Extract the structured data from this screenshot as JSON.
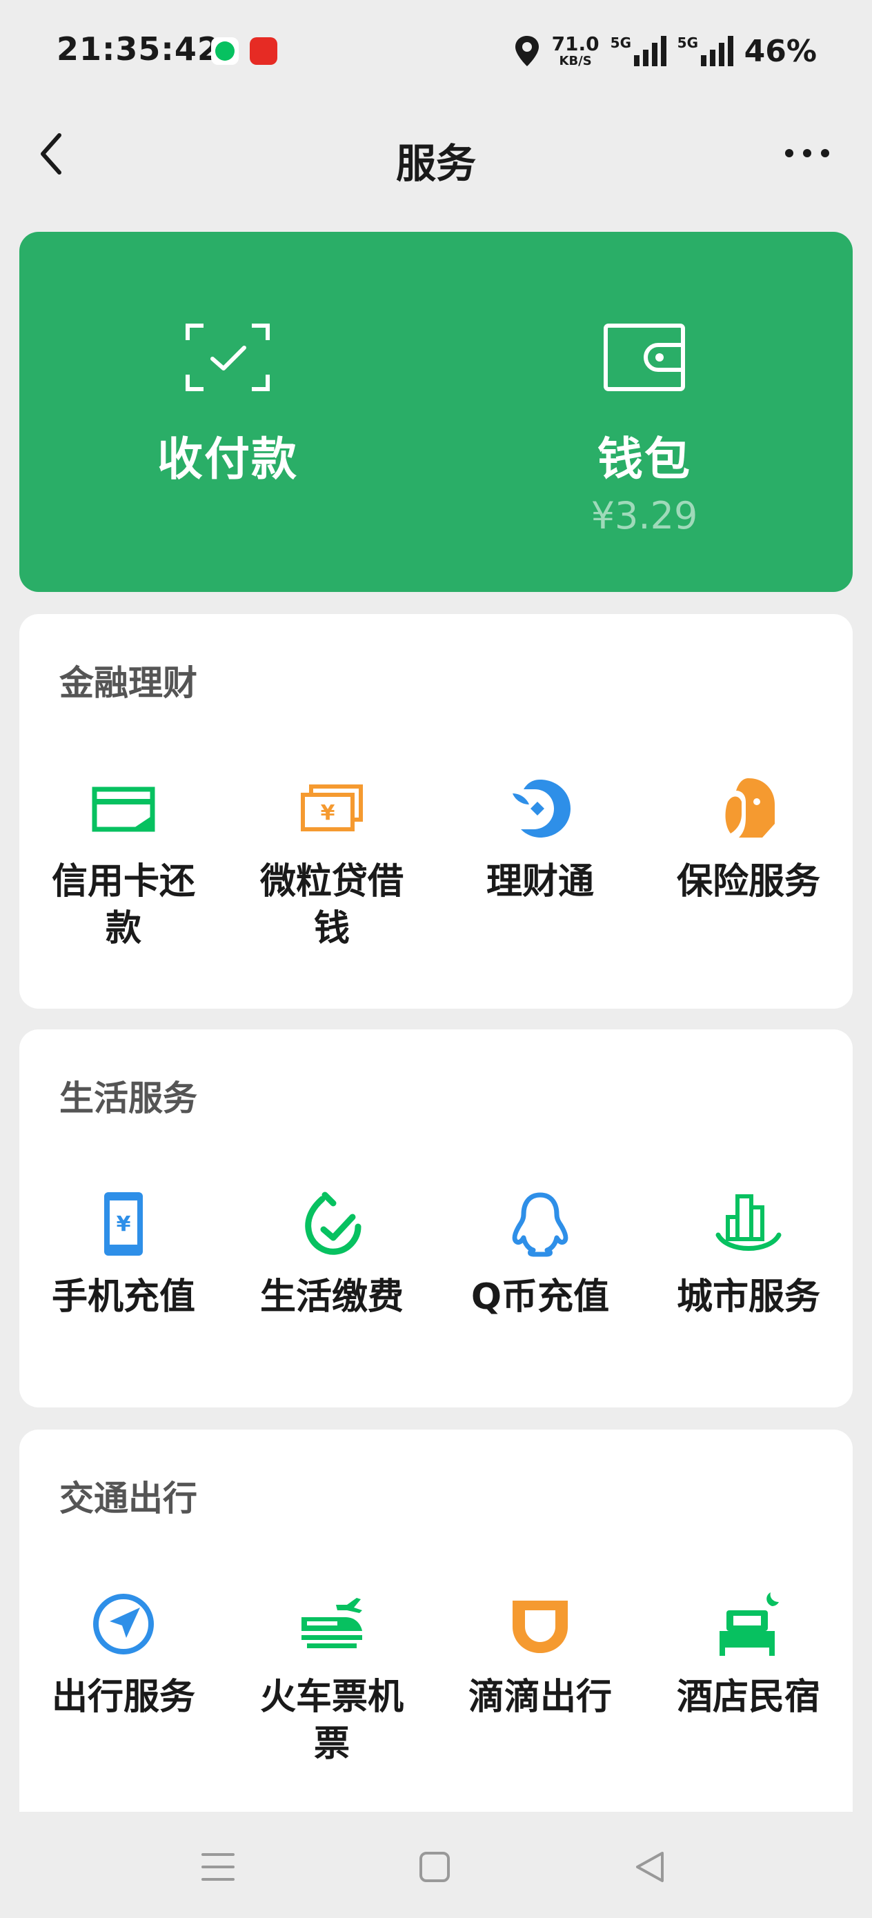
{
  "status_bar": {
    "time": "21:35:42",
    "net_speed": "71.0",
    "net_unit": "KB/S",
    "sim1": "5G",
    "sim2": "5G",
    "battery": "46%",
    "icons": [
      "messaging-app-icon",
      "cloud-pay-app-icon",
      "location-icon",
      "signal-icon"
    ]
  },
  "nav": {
    "title": "服务",
    "back_icon": "chevron-left-icon",
    "more_icon": "more-dots-icon"
  },
  "hero": {
    "items": [
      {
        "label": "收付款",
        "icon": "scan-check-icon"
      },
      {
        "label": "钱包",
        "sub": "¥3.29",
        "icon": "wallet-icon"
      }
    ]
  },
  "sections": [
    {
      "title": "金融理财",
      "items": [
        {
          "label": "信用卡还款",
          "icon": "credit-card-icon",
          "color": "#07c160"
        },
        {
          "label": "微粒贷借钱",
          "icon": "loan-notes-icon",
          "color": "#f59a30"
        },
        {
          "label": "理财通",
          "icon": "wealth-fish-icon",
          "color": "#2e8fe8"
        },
        {
          "label": "保险服务",
          "icon": "insurance-umbrella-icon",
          "color": "#f59a30"
        }
      ]
    },
    {
      "title": "生活服务",
      "items": [
        {
          "label": "手机充值",
          "icon": "phone-recharge-icon",
          "color": "#2e8fe8"
        },
        {
          "label": "生活缴费",
          "icon": "utility-check-icon",
          "color": "#07c160"
        },
        {
          "label": "Q币充值",
          "icon": "qq-penguin-icon",
          "color": "#2e8fe8"
        },
        {
          "label": "城市服务",
          "icon": "city-buildings-icon",
          "color": "#07c160"
        }
      ]
    },
    {
      "title": "交通出行",
      "items": [
        {
          "label": "出行服务",
          "icon": "navigation-arrow-icon",
          "color": "#2e8fe8"
        },
        {
          "label": "火车票机票",
          "icon": "train-plane-icon",
          "color": "#07c160"
        },
        {
          "label": "滴滴出行",
          "icon": "didi-icon",
          "color": "#f59a30"
        },
        {
          "label": "酒店民宿",
          "icon": "hotel-bed-icon",
          "color": "#07c160"
        }
      ]
    }
  ],
  "system_nav": {
    "icons": [
      "menu-icon",
      "home-square-icon",
      "back-triangle-icon"
    ]
  }
}
